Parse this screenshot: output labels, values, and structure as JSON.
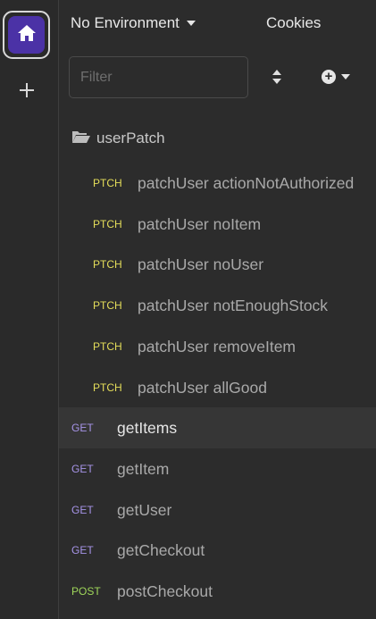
{
  "environment": {
    "label": "No Environment"
  },
  "cookies": {
    "label": "Cookies"
  },
  "filter": {
    "placeholder": "Filter",
    "value": ""
  },
  "folder": {
    "name": "userPatch"
  },
  "folder_requests": [
    {
      "method": "PTCH",
      "name": "patchUser actionNotAuthorized"
    },
    {
      "method": "PTCH",
      "name": "patchUser noItem"
    },
    {
      "method": "PTCH",
      "name": "patchUser noUser"
    },
    {
      "method": "PTCH",
      "name": "patchUser notEnoughStock"
    },
    {
      "method": "PTCH",
      "name": "patchUser removeItem"
    },
    {
      "method": "PTCH",
      "name": "patchUser allGood"
    }
  ],
  "requests": [
    {
      "method": "GET",
      "name": "getItems",
      "active": true
    },
    {
      "method": "GET",
      "name": "getItem"
    },
    {
      "method": "GET",
      "name": "getUser"
    },
    {
      "method": "GET",
      "name": "getCheckout"
    },
    {
      "method": "POST",
      "name": "postCheckout"
    }
  ],
  "colors": {
    "accent": "#4b32a6",
    "ptch": "#e5de5a",
    "get": "#a794e8",
    "post": "#9fd65a",
    "background": "#2c2c2c"
  },
  "icons": [
    "home-icon",
    "plus-icon",
    "caret-down-icon",
    "sort-icon",
    "plus-circle-icon",
    "folder-open-icon"
  ]
}
